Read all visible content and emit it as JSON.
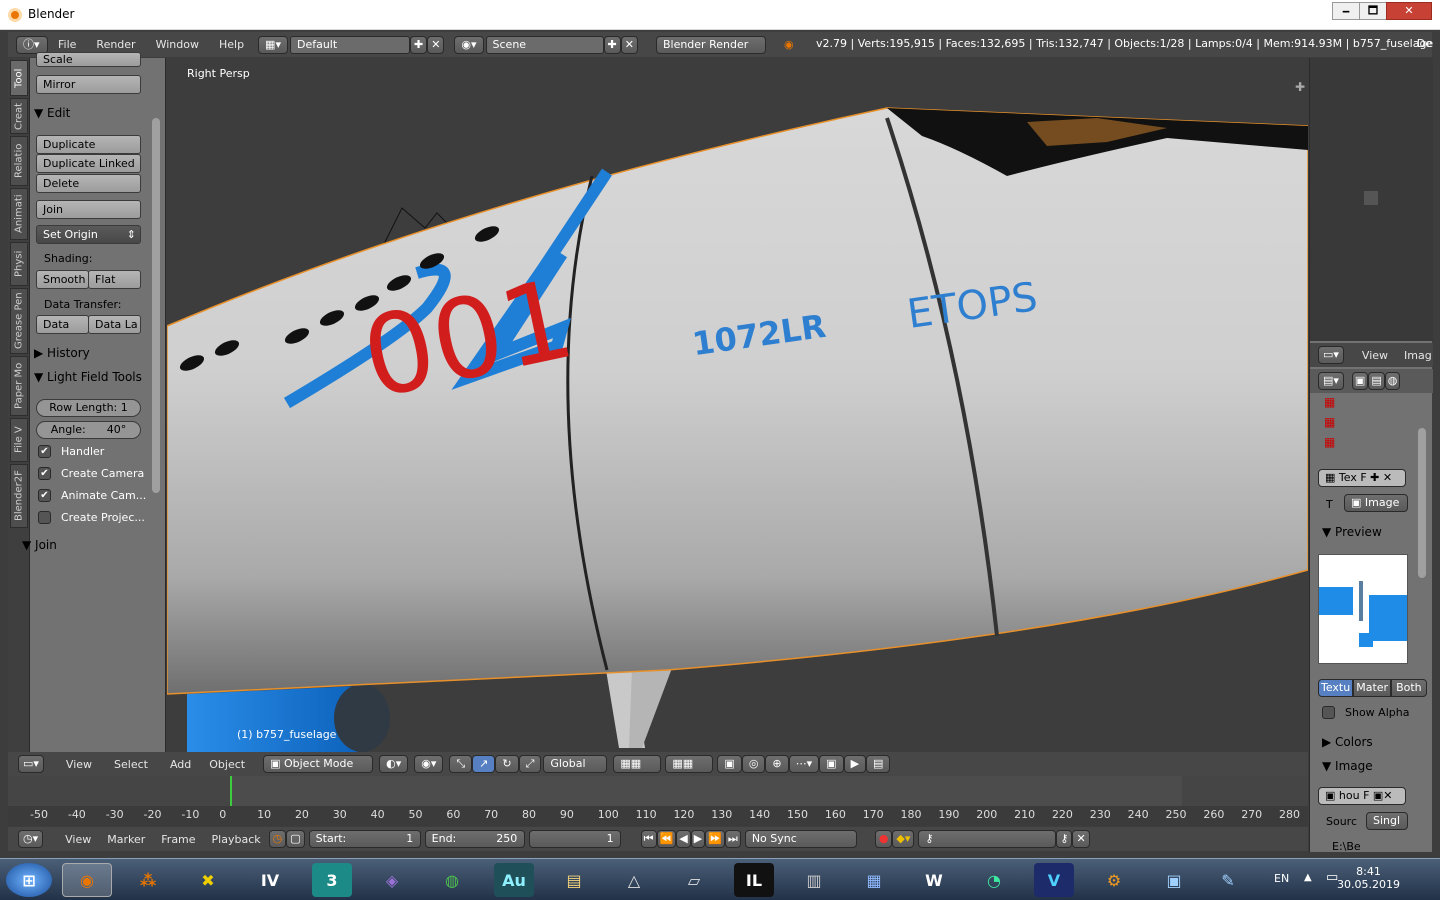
{
  "window": {
    "title": "Blender",
    "minimize": "🗕",
    "maximize": "🗖",
    "close": "✕"
  },
  "infobar": {
    "menus": [
      "File",
      "Render",
      "Window",
      "Help"
    ],
    "layout": "Default",
    "scene": "Scene",
    "engine": "Blender Render",
    "stats": "v2.79 | Verts:195,915 | Faces:132,695 | Tris:132,747 | Objects:1/28 | Lamps:0/4 | Mem:914.93M | b757_fuselage",
    "extra": "De"
  },
  "left_tabs": [
    "Tool",
    "Creat",
    "Relatio",
    "Animati",
    "Physi",
    "Grease Pen",
    "Paper Mo",
    "File V",
    "Blender2F"
  ],
  "toolshelf": {
    "scale": "Scale",
    "mirror": "Mirror",
    "edit_header": "Edit",
    "duplicate": "Duplicate",
    "duplicate_linked": "Duplicate Linked",
    "delete": "Delete",
    "join": "Join",
    "set_origin": "Set Origin",
    "shading_label": "Shading:",
    "smooth": "Smooth",
    "flat": "Flat",
    "data_transfer_label": "Data Transfer:",
    "data": "Data",
    "data_la": "Data La",
    "history_header": "History",
    "lightfield_header": "Light Field Tools",
    "row_length": "Row Length:  1",
    "angle_label": "Angle:",
    "angle_value": "40°",
    "checks": [
      {
        "label": "Handler",
        "checked": true
      },
      {
        "label": "Create Camera",
        "checked": true
      },
      {
        "label": "Animate Cam...",
        "checked": true
      },
      {
        "label": "Create Projec...",
        "checked": false
      }
    ],
    "join_header": "Join"
  },
  "viewport": {
    "view_label": "Right Persp",
    "object_label": "(1) b757_fuselage",
    "decals": {
      "number": "001",
      "model": "1072LR",
      "etops": "ETOPS"
    }
  },
  "view3d_header": {
    "menus": [
      "View",
      "Select",
      "Add",
      "Object"
    ],
    "mode": "Object Mode",
    "orientation": "Global"
  },
  "timeline": {
    "ticks": [
      "-50",
      "-40",
      "-30",
      "-20",
      "-10",
      "0",
      "10",
      "20",
      "30",
      "40",
      "50",
      "60",
      "70",
      "80",
      "90",
      "100",
      "110",
      "120",
      "130",
      "140",
      "150",
      "160",
      "170",
      "180",
      "190",
      "200",
      "210",
      "220",
      "230",
      "240",
      "250",
      "260",
      "270",
      "280"
    ],
    "menus": [
      "View",
      "Marker",
      "Frame",
      "Playback"
    ],
    "start_label": "Start:",
    "start": "1",
    "end_label": "End:",
    "end": "250",
    "current": "1",
    "sync": "No Sync"
  },
  "right_panel": {
    "view": "View",
    "image": "Imag",
    "tex": "Tex",
    "f": "F",
    "t_label": "T",
    "image_type": "Image",
    "preview_header": "Preview",
    "tabs": [
      "Textu",
      "Mater",
      "Both"
    ],
    "show_alpha": "Show Alpha",
    "colors_header": "Colors",
    "image_header": "Image",
    "image_name": "hou",
    "source_label": "Sourc",
    "source_value": "Singl",
    "path": "E:\\Be"
  },
  "taskbar": {
    "icons": [
      "start-orb",
      "blender",
      "app-orange",
      "app-x",
      "app-iv",
      "3dsmax",
      "visual-studio",
      "globe",
      "audition",
      "explorer",
      "triangle",
      "paper",
      "intellij",
      "synth",
      "calendar",
      "w",
      "gauge",
      "v",
      "gear",
      "network",
      "paint"
    ],
    "lang": "EN",
    "time": "8:41",
    "date": "30.05.2019"
  }
}
